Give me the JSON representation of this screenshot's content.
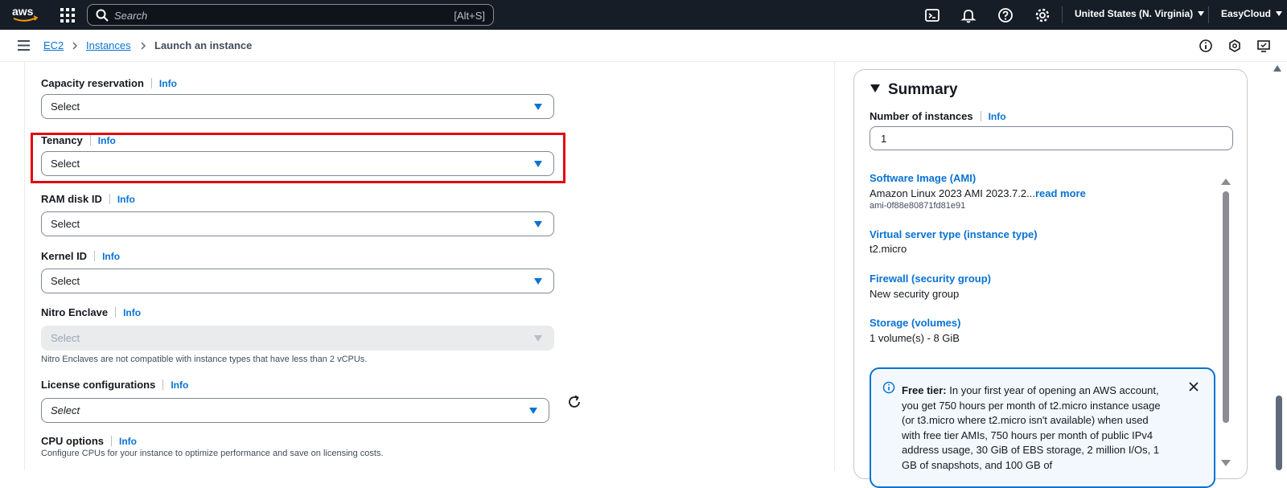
{
  "topnav": {
    "logo_text": "aws",
    "search_placeholder": "Search",
    "search_shortcut": "[Alt+S]",
    "region": "United States (N. Virginia)",
    "account": "EasyCloud"
  },
  "breadcrumb": {
    "items": [
      "EC2",
      "Instances"
    ],
    "current": "Launch an instance"
  },
  "form": {
    "info_label": "Info",
    "capacity_reservation": {
      "label": "Capacity reservation",
      "value": "Select"
    },
    "tenancy": {
      "label": "Tenancy",
      "value": "Select"
    },
    "ram_disk_id": {
      "label": "RAM disk ID",
      "value": "Select"
    },
    "kernel_id": {
      "label": "Kernel ID",
      "value": "Select"
    },
    "nitro_enclave": {
      "label": "Nitro Enclave",
      "value": "Select",
      "help": "Nitro Enclaves are not compatible with instance types that have less than 2 vCPUs."
    },
    "license_configurations": {
      "label": "License configurations",
      "value": "Select"
    },
    "cpu_options": {
      "label": "CPU options",
      "help": "Configure CPUs for your instance to optimize performance and save on licensing costs."
    }
  },
  "summary": {
    "title": "Summary",
    "num_instances_label": "Number of instances",
    "info_label": "Info",
    "num_instances_value": "1",
    "ami_title": "Software Image (AMI)",
    "ami_value": "Amazon Linux 2023 AMI 2023.7.2...",
    "ami_readmore": "read more",
    "ami_id": "ami-0f88e80871fd81e91",
    "instance_type_title": "Virtual server type (instance type)",
    "instance_type_value": "t2.micro",
    "firewall_title": "Firewall (security group)",
    "firewall_value": "New security group",
    "storage_title": "Storage (volumes)",
    "storage_value": "1 volume(s) - 8 GiB",
    "free_tier_bold": "Free tier:",
    "free_tier_text": " In your first year of opening an AWS account, you get 750 hours per month of t2.micro instance usage (or t3.micro where t2.micro isn't available) when used with free tier AMIs, 750 hours per month of public IPv4 address usage, 30 GiB of EBS storage, 2 million I/Os, 1 GB of snapshots, and 100 GB of"
  },
  "colors": {
    "topnav_bg": "#161d26",
    "link": "#0972d3",
    "highlight": "#e1060f"
  }
}
